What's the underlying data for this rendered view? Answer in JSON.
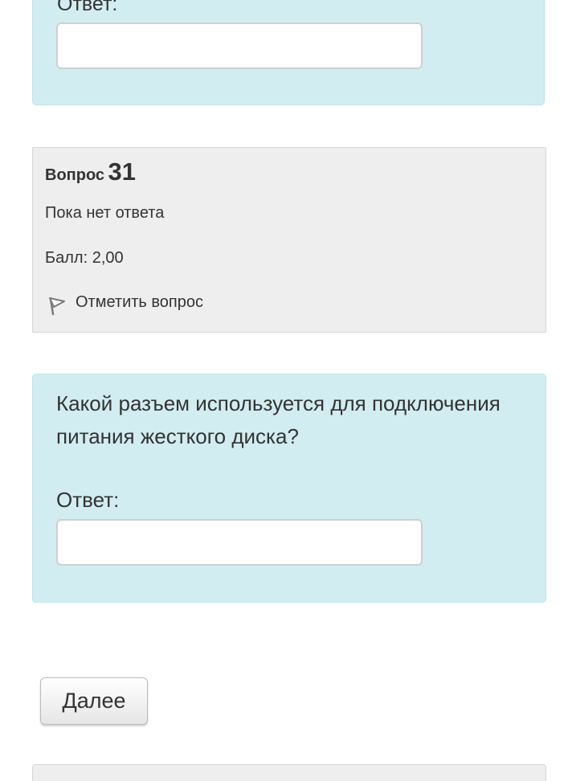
{
  "previous_question": {
    "answer_label": "Ответ:",
    "answer_value": ""
  },
  "question": {
    "label_word": "Вопрос",
    "number": "31",
    "state": "Пока нет ответа",
    "grade": "Балл: 2,00",
    "flag_label": "Отметить вопрос",
    "flag_icon": "flag-icon",
    "text": "Какой разъем используется для подключения питания жесткого диска?",
    "answer_label": "Ответ:",
    "answer_value": ""
  },
  "navigation": {
    "next_label": "Далее"
  },
  "colors": {
    "formulation_bg": "#d2edf1",
    "info_bg": "#eeeeee",
    "text": "#333333"
  }
}
